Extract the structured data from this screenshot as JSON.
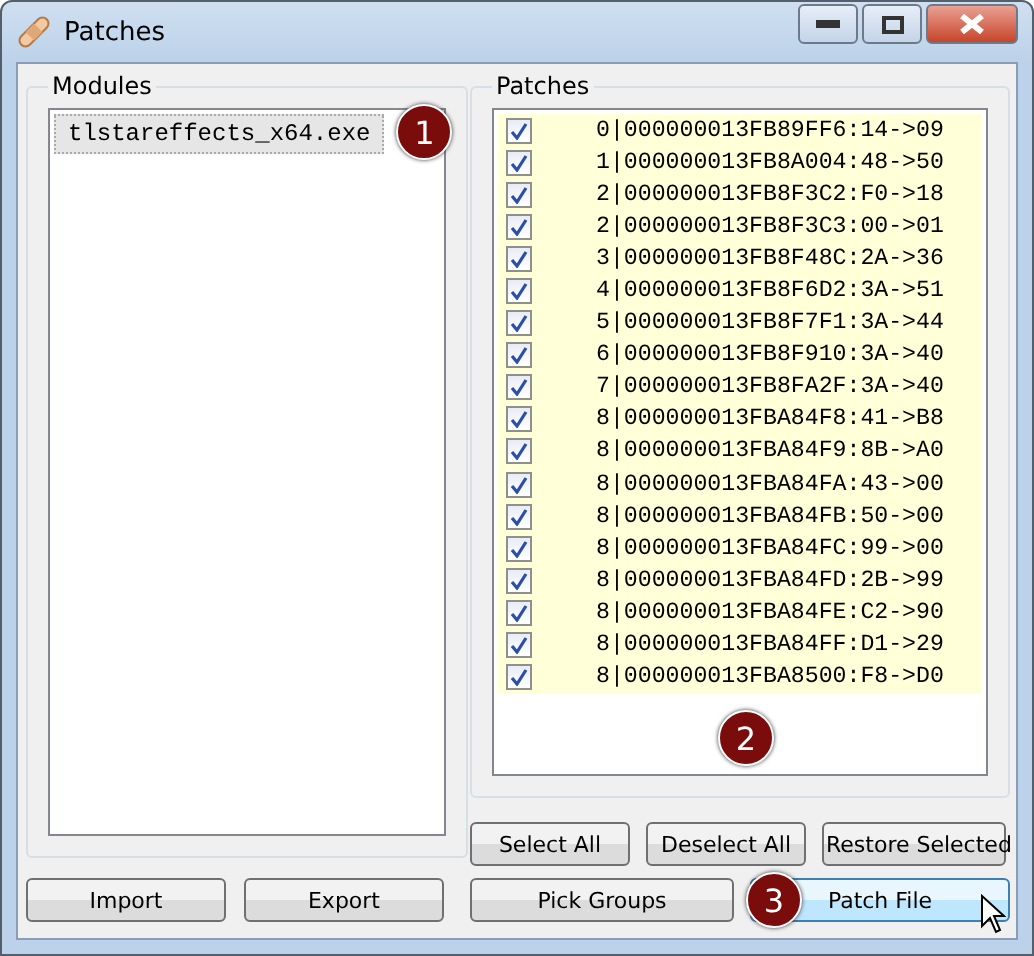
{
  "window": {
    "title": "Patches"
  },
  "modules": {
    "title": "Modules",
    "items": [
      {
        "label": "tlstareffects_x64.exe",
        "selected": true,
        "callout": "1"
      }
    ]
  },
  "patches": {
    "title": "Patches",
    "callout": "2",
    "rows": [
      {
        "text": "0|000000013FB89FF6:14->09",
        "checked": true
      },
      {
        "text": "1|000000013FB8A004:48->50",
        "checked": true
      },
      {
        "text": "2|000000013FB8F3C2:F0->18",
        "checked": true
      },
      {
        "text": "2|000000013FB8F3C3:00->01",
        "checked": true
      },
      {
        "text": "3|000000013FB8F48C:2A->36",
        "checked": true
      },
      {
        "text": "4|000000013FB8F6D2:3A->51",
        "checked": true
      },
      {
        "text": "5|000000013FB8F7F1:3A->44",
        "checked": true
      },
      {
        "text": "6|000000013FB8F910:3A->40",
        "checked": true
      },
      {
        "text": "7|000000013FB8FA2F:3A->40",
        "checked": true
      },
      {
        "text": "8|000000013FBA84F8:41->B8",
        "checked": true
      },
      {
        "text": "8|000000013FBA84F9:8B->A0",
        "checked": true
      },
      {
        "text": "8|000000013FBA84FA:43->00",
        "checked": true
      },
      {
        "text": "8|000000013FBA84FB:50->00",
        "checked": true
      },
      {
        "text": "8|000000013FBA84FC:99->00",
        "checked": true
      },
      {
        "text": "8|000000013FBA84FD:2B->99",
        "checked": true
      },
      {
        "text": "8|000000013FBA84FE:C2->90",
        "checked": true
      },
      {
        "text": "8|000000013FBA84FF:D1->29",
        "checked": true
      },
      {
        "text": "8|000000013FBA8500:F8->D0",
        "checked": true
      }
    ]
  },
  "left_buttons": [
    {
      "label": "Import",
      "hovered": false
    },
    {
      "label": "Export",
      "hovered": false
    }
  ],
  "right_buttons_top": [
    {
      "label": "Select All",
      "hovered": false
    },
    {
      "label": "Deselect All",
      "hovered": false
    },
    {
      "label": "Restore Selected",
      "hovered": false
    }
  ],
  "right_buttons_bottom": [
    {
      "label": "Pick Groups",
      "hovered": false
    },
    {
      "label": "Patch File",
      "hovered": true,
      "callout": "3"
    }
  ]
}
